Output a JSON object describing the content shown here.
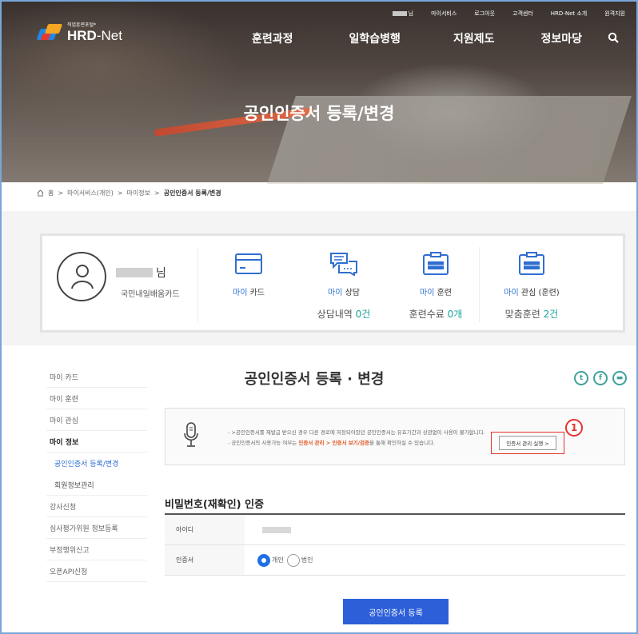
{
  "header": {
    "topbar": {
      "user_suffix": "님",
      "links": [
        "마이서비스",
        "로그아웃",
        "고객센터",
        "HRD-Net 소개",
        "원격지원"
      ]
    },
    "logo": {
      "small": "직업훈련포털*",
      "big_a": "HRD",
      "big_b": "-Net"
    },
    "gnb": [
      "훈련과정",
      "일학습병행",
      "지원제도",
      "정보마당"
    ],
    "hero_title": "공인인증서 등록/변경",
    "search_icon": "search-icon"
  },
  "breadcrumb": {
    "home": "홈",
    "sep": ">",
    "items": [
      "마이서비스(개인)",
      "마이정보"
    ],
    "current": "공인인증서 등록/변경"
  },
  "mycard": {
    "user_suffix": "님",
    "card_type": "국민내일배움카드",
    "stats": [
      {
        "pre": "마이",
        "label": " 카드",
        "count_label": "",
        "count": "",
        "count_unit": "",
        "icon": "card-icon"
      },
      {
        "pre": "마이",
        "label": " 상담",
        "count_label": "상담내역 ",
        "count": "0",
        "count_unit": "건",
        "icon": "chat-icon"
      },
      {
        "pre": "마이",
        "label": " 훈련",
        "count_label": "훈련수료 ",
        "count": "0",
        "count_unit": "개",
        "icon": "clipboard-icon"
      },
      {
        "pre": "마이",
        "label": " 관심 (훈련)",
        "count_label": "맞춤훈련 ",
        "count": "2",
        "count_unit": "건",
        "icon": "clipboard-icon"
      }
    ]
  },
  "left_nav": [
    {
      "label": "마이 카드"
    },
    {
      "label": "마이 훈련"
    },
    {
      "label": "마이 관심"
    },
    {
      "label": "마이 정보"
    },
    {
      "label": "공인인증서 등록/변경"
    },
    {
      "label": "회원정보관리"
    },
    {
      "label": "강사신청"
    },
    {
      "label": "심사평가위원 정보등록"
    },
    {
      "label": "부정행위신고"
    },
    {
      "label": "오픈API신청"
    }
  ],
  "content": {
    "title": "공인인증서 등록 · 변경",
    "sns": [
      "twitter-icon",
      "facebook-icon",
      "share-icon"
    ],
    "notice": {
      "line1": "- >공인인증서를 재발급 받으신 경우 다른 경로에 저장되어있던 공인인증서는 유효기간과 상관없이 사용이 불가합니다.",
      "line2_pre": "- 공인인증서의 사용가능 여부는 ",
      "line2_hl": "인증서 관리 > 인증서 보기/검증",
      "line2_post": "을 통해 확인하실 수 있습니다.",
      "button": "인증서 관리 실행 >",
      "badge": "1"
    },
    "section_title": "비밀번호(재확인) 인증",
    "rows": [
      {
        "label": "아이디"
      },
      {
        "label": "인증서",
        "options": [
          "개인",
          "법인"
        ],
        "selected": "개인"
      }
    ],
    "submit": "공인인증서 등록"
  }
}
